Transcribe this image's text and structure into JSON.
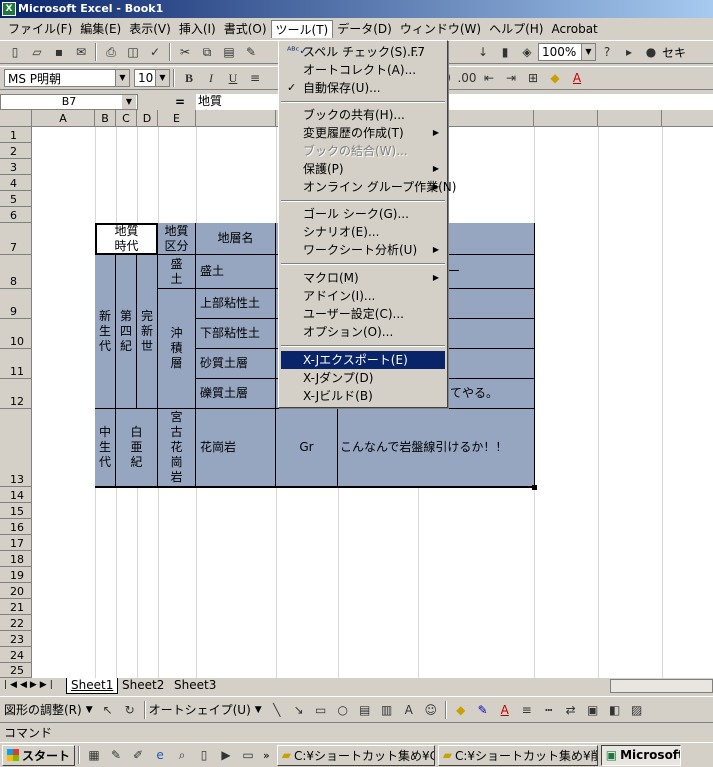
{
  "window": {
    "title": "Microsoft Excel - Book1"
  },
  "menu_bar": [
    {
      "label": "ファイル(F)"
    },
    {
      "label": "編集(E)"
    },
    {
      "label": "表示(V)"
    },
    {
      "label": "挿入(I)"
    },
    {
      "label": "書式(O)"
    },
    {
      "label": "ツール(T)"
    },
    {
      "label": "データ(D)"
    },
    {
      "label": "ウィンドウ(W)"
    },
    {
      "label": "ヘルプ(H)"
    },
    {
      "label": "Acrobat"
    }
  ],
  "standard_toolbar": {
    "zoom": "100%",
    "extra_label": "セキ"
  },
  "format_toolbar": {
    "font": "MS P明朝",
    "size": "10",
    "bold": "B",
    "italic": "I",
    "underline": "U"
  },
  "formula_bar": {
    "name_box": "B7",
    "equals": "=",
    "value_line1": "地質",
    "value_line2": "時代"
  },
  "columns": [
    "A",
    "B",
    "C",
    "D",
    "E"
  ],
  "rows": [
    "1",
    "2",
    "3",
    "4",
    "5",
    "6",
    "7",
    "8",
    "9",
    "10",
    "11",
    "12",
    "13",
    "14",
    "15",
    "16",
    "17",
    "18",
    "19",
    "20",
    "21",
    "22",
    "23",
    "24",
    "25"
  ],
  "table": {
    "header_period": "地質\n時代",
    "header_class": "地質\n区分",
    "header_layer": "地層名",
    "era": "新\n生\n代",
    "period": "第\n四\n紀",
    "epoch": "完\n新\n世",
    "fill_class": "盛\n土",
    "alluvial_class": "沖\n積\n層",
    "layers": [
      "盛土",
      "上部粘性土",
      "下部粘性土",
      "砂質土層",
      "礫質土層"
    ],
    "col_f_row8": "ー",
    "col_g_row12": "てやる。",
    "mesozoic_era": "中\n生\n代",
    "cretaceous": "白\n亜\n紀",
    "miyako": "宮\n古\n花\n崗\n岩",
    "granite_name": "花崗岩",
    "granite_symbol": "Gr",
    "granite_note": "こんなんで岩盤線引けるか！！"
  },
  "tools_menu": {
    "items": [
      {
        "label": "スペル チェック(S)...",
        "shortcut": "F7",
        "icon": "spellcheck-icon"
      },
      {
        "label": "オートコレクト(A)..."
      },
      {
        "label": "自動保存(U)...",
        "checked": "✓"
      },
      {
        "label": "ブックの共有(H)..."
      },
      {
        "label": "変更履歴の作成(T)",
        "submenu": "▶"
      },
      {
        "label": "ブックの結合(W)...",
        "disabled": true
      },
      {
        "label": "保護(P)",
        "submenu": "▶"
      },
      {
        "label": "オンライン グループ作業(N)",
        "submenu": "▶"
      },
      {
        "label": "ゴール シーク(G)..."
      },
      {
        "label": "シナリオ(E)..."
      },
      {
        "label": "ワークシート分析(U)",
        "submenu": "▶"
      },
      {
        "label": "マクロ(M)",
        "submenu": "▶"
      },
      {
        "label": "アドイン(I)..."
      },
      {
        "label": "ユーザー設定(C)..."
      },
      {
        "label": "オプション(O)..."
      },
      {
        "label": "X-Jエクスポート(E)",
        "selected": true
      },
      {
        "label": "X-Jダンプ(D)"
      },
      {
        "label": "X-Jビルド(B)"
      }
    ]
  },
  "sheet_tabs": [
    {
      "label": "Sheet1"
    },
    {
      "label": "Sheet2"
    },
    {
      "label": "Sheet3"
    }
  ],
  "drawing_toolbar": {
    "draw_label": "図形の調整(R)",
    "autoshape_label": "オートシェイプ(U)"
  },
  "status_bar": {
    "text": "コマンド"
  },
  "taskbar": {
    "start": "スタート",
    "tasks": [
      {
        "label": "C:¥ショートカット集め¥CAD"
      },
      {
        "label": "C:¥ショートカット集め¥削造..."
      },
      {
        "label": "Microsoft"
      }
    ]
  }
}
